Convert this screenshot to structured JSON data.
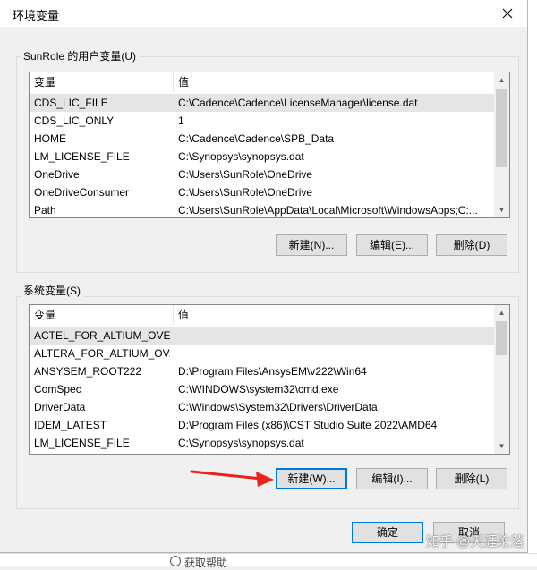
{
  "dialog": {
    "title": "环境变量",
    "ok_label": "确定",
    "cancel_label": "取消"
  },
  "user_vars": {
    "group_label": "SunRole 的用户变量(U)",
    "headers": [
      "变量",
      "值"
    ],
    "rows": [
      {
        "name": "CDS_LIC_FILE",
        "value": "C:\\Cadence\\Cadence\\LicenseManager\\license.dat",
        "selected": true
      },
      {
        "name": "CDS_LIC_ONLY",
        "value": "1"
      },
      {
        "name": "HOME",
        "value": "C:\\Cadence\\Cadence\\SPB_Data"
      },
      {
        "name": "LM_LICENSE_FILE",
        "value": "C:\\Synopsys\\synopsys.dat"
      },
      {
        "name": "OneDrive",
        "value": "C:\\Users\\SunRole\\OneDrive"
      },
      {
        "name": "OneDriveConsumer",
        "value": "C:\\Users\\SunRole\\OneDrive"
      },
      {
        "name": "Path",
        "value": "C:\\Users\\SunRole\\AppData\\Local\\Microsoft\\WindowsApps;C:..."
      }
    ],
    "buttons": {
      "new": "新建(N)...",
      "edit": "编辑(E)...",
      "delete": "删除(D)"
    }
  },
  "system_vars": {
    "group_label": "系统变量(S)",
    "headers": [
      "变量",
      "值"
    ],
    "rows": [
      {
        "name": "ACTEL_FOR_ALTIUM_OVE...",
        "value": "",
        "selected": true
      },
      {
        "name": "ALTERA_FOR_ALTIUM_OV...",
        "value": ""
      },
      {
        "name": "ANSYSEM_ROOT222",
        "value": "D:\\Program Files\\AnsysEM\\v222\\Win64"
      },
      {
        "name": "ComSpec",
        "value": "C:\\WINDOWS\\system32\\cmd.exe"
      },
      {
        "name": "DriverData",
        "value": "C:\\Windows\\System32\\Drivers\\DriverData"
      },
      {
        "name": "IDEM_LATEST",
        "value": "D:\\Program Files (x86)\\CST Studio Suite 2022\\AMD64"
      },
      {
        "name": "LM_LICENSE_FILE",
        "value": "C:\\Synopsys\\synopsys.dat"
      }
    ],
    "buttons": {
      "new": "新建(W)...",
      "edit": "编辑(I)...",
      "delete": "删除(L)"
    }
  },
  "background": {
    "bottom_text": "获取帮助"
  },
  "watermark": "知乎 @天涯沦落",
  "colors": {
    "accent": "#0078d7",
    "annotation_arrow": "#e8231c",
    "selection": "#e5e5e5"
  },
  "icons": [
    "close-icon",
    "scroll-up-icon",
    "scroll-down-icon",
    "annotation-arrow"
  ]
}
